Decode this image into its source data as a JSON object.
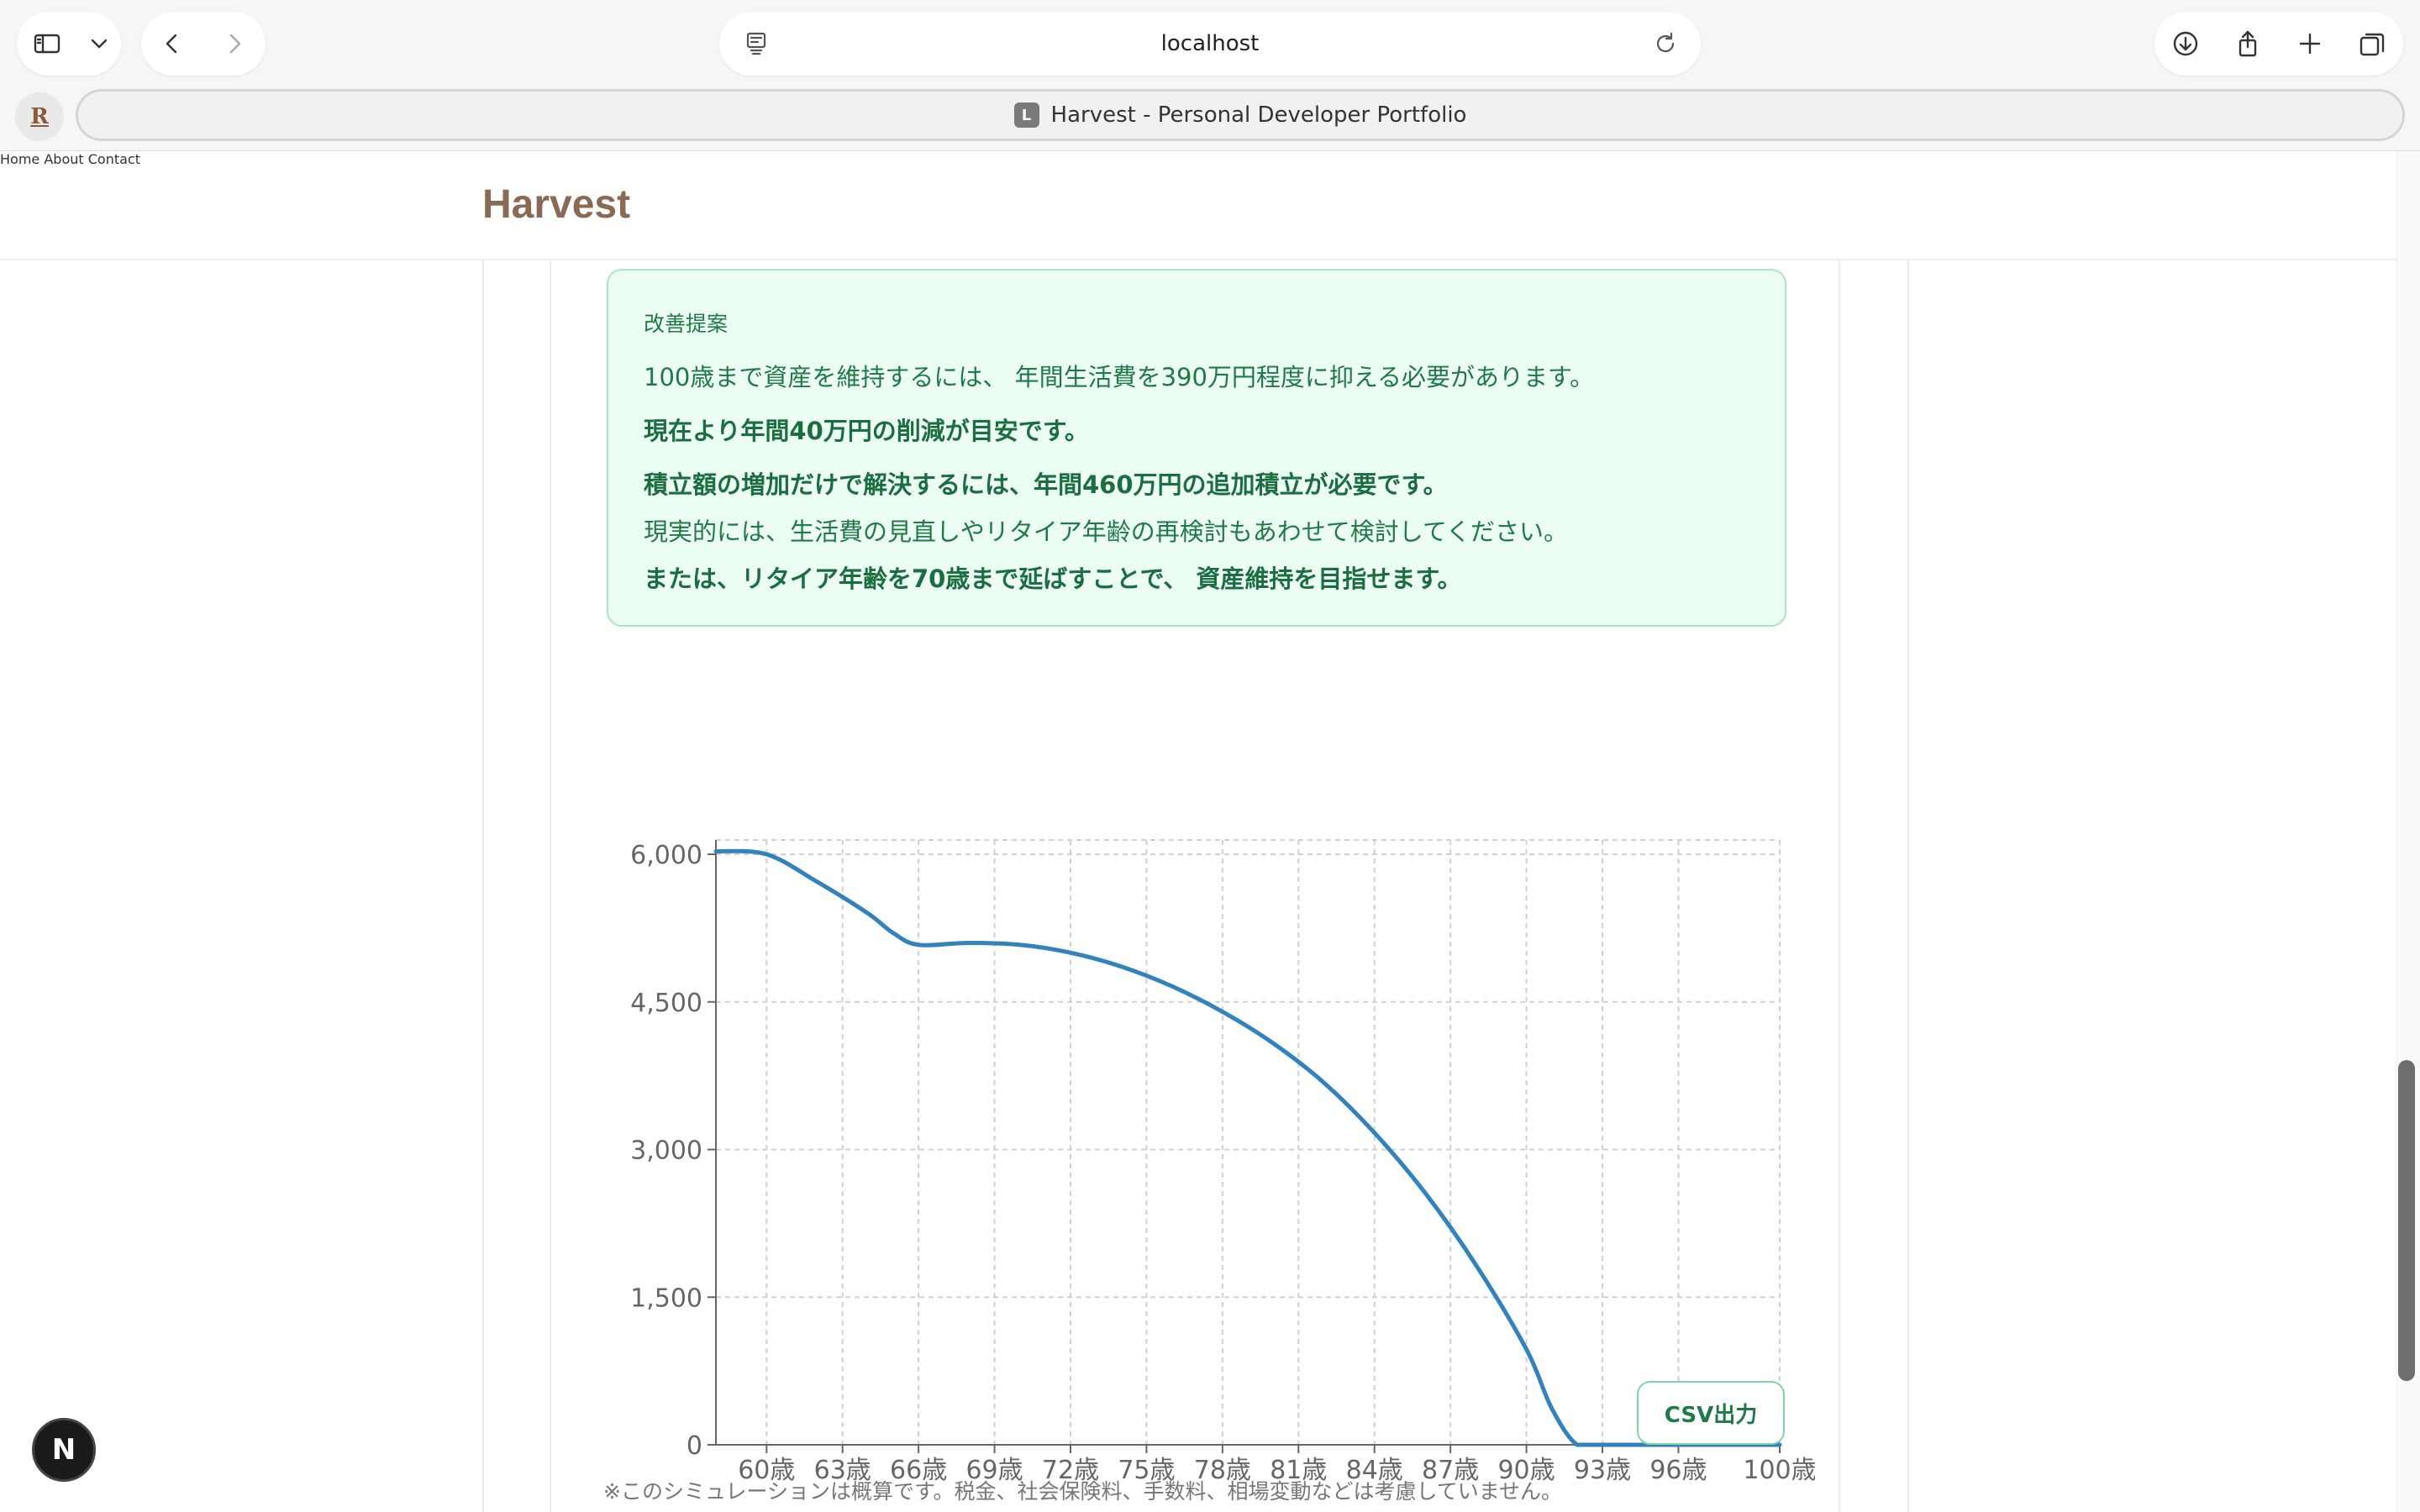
{
  "browser": {
    "url": "localhost",
    "tab_title": "Harvest - Personal Developer Portfolio",
    "tab_favicon_letter": "L",
    "pinned_favicon_letter": "R"
  },
  "site": {
    "brand": "Harvest",
    "nav": [
      "Home",
      "About",
      "Contact"
    ]
  },
  "suggestion": {
    "title": "改善提案",
    "lines": [
      "100歳まで資産を維持するには、 年間生活費を390万円程度に抑える必要があります。",
      "現在より年間40万円の削減が目安です。",
      "積立額の増加だけで解決するには、年間460万円の追加積立が必要です。",
      "現実的には、生活費の見直しやリタイア年齢の再検討もあわせて検討してください。",
      "または、リタイア年齢を70歳まで延ばすことで、 資産維持を目指せます。"
    ]
  },
  "chart_data": {
    "type": "line",
    "x": [
      58,
      60,
      62,
      64,
      65,
      66,
      68,
      70,
      72,
      74,
      76,
      78,
      80,
      82,
      84,
      86,
      88,
      90,
      91,
      92,
      93,
      96,
      100
    ],
    "y": [
      6030,
      6000,
      5720,
      5400,
      5200,
      5080,
      5100,
      5080,
      5000,
      4860,
      4660,
      4400,
      4080,
      3680,
      3170,
      2560,
      1830,
      970,
      370,
      0,
      0,
      0,
      0
    ],
    "x_ticks": [
      "60歳",
      "63歳",
      "66歳",
      "69歳",
      "72歳",
      "75歳",
      "78歳",
      "81歳",
      "84歳",
      "87歳",
      "90歳",
      "93歳",
      "96歳",
      "100歳"
    ],
    "y_ticks": [
      "0",
      "1,500",
      "3,000",
      "4,500",
      "6,000"
    ],
    "ylim": [
      0,
      6000
    ],
    "grid": true,
    "line_color": "#3182bd"
  },
  "actions": {
    "csv_label": "CSV出力"
  },
  "footnote": "※このシミュレーションは概算です。税金、社会保険料、手数料、相場変動などは考慮していません。",
  "dev_badge": "N"
}
